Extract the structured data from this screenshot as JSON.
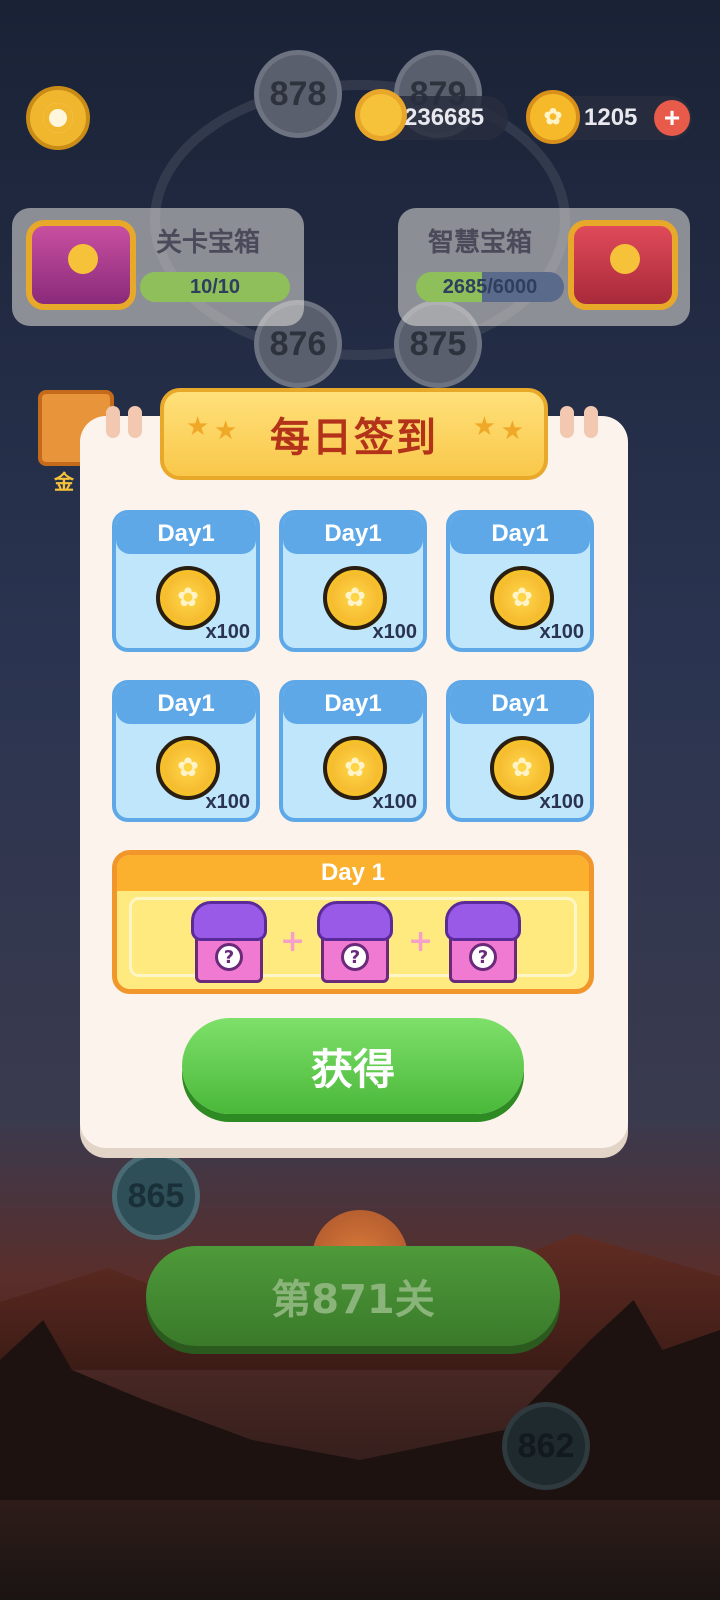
{
  "map": {
    "level_nodes": [
      "878",
      "879",
      "876",
      "875",
      "865",
      "862"
    ],
    "play_button_label": "第871关"
  },
  "topbar": {
    "energy_value": "236685",
    "coins_value": "1205",
    "add_symbol": "+"
  },
  "chests": {
    "level_chest": {
      "title": "关卡宝箱",
      "progress": "10/10",
      "progress_fraction": 1.0
    },
    "wisdom_chest": {
      "title": "智慧宝箱",
      "progress": "2685/6000",
      "progress_fraction": 0.4475
    }
  },
  "side_gift_label": "金",
  "dialog": {
    "title": "每日签到",
    "rewards": [
      {
        "day": "Day1",
        "count": "x100"
      },
      {
        "day": "Day1",
        "count": "x100"
      },
      {
        "day": "Day1",
        "count": "x100"
      },
      {
        "day": "Day1",
        "count": "x100"
      },
      {
        "day": "Day1",
        "count": "x100"
      },
      {
        "day": "Day1",
        "count": "x100"
      }
    ],
    "big_reward": {
      "day": "Day 1",
      "gift_symbol": "?"
    },
    "claim_label": "获得"
  },
  "colors": {
    "accent_gold": "#f9c84a",
    "reward_blue": "#5fa8e8",
    "claim_green": "#4ab83a",
    "title_red": "#b2321a"
  }
}
